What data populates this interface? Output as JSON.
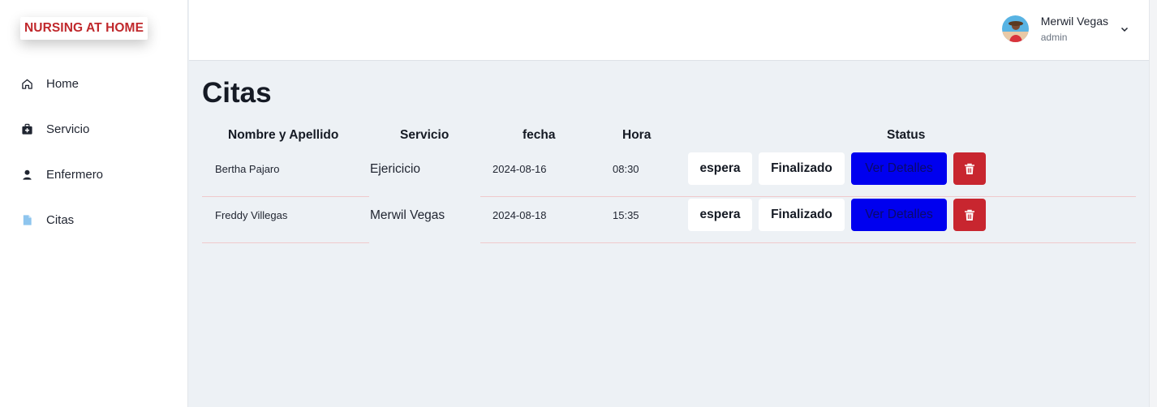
{
  "brand": {
    "name": "NURSING AT HOME"
  },
  "sidebar": {
    "items": [
      {
        "label": "Home",
        "icon": "home-icon"
      },
      {
        "label": "Servicio",
        "icon": "medical-bag-icon"
      },
      {
        "label": "Enfermero",
        "icon": "user-icon"
      },
      {
        "label": "Citas",
        "icon": "document-icon"
      }
    ]
  },
  "user": {
    "name": "Merwil Vegas",
    "role": "admin"
  },
  "page": {
    "title": "Citas"
  },
  "table": {
    "headers": {
      "nombre": "Nombre y Apellido",
      "servicio": "Servicio",
      "fecha": "fecha",
      "hora": "Hora",
      "status": "Status"
    },
    "rows": [
      {
        "nombre": "Bertha Pajaro",
        "servicio": "Ejericicio",
        "fecha": "2024-08-16",
        "hora": "08:30"
      },
      {
        "nombre": "Freddy Villegas",
        "servicio": "Merwil Vegas",
        "fecha": "2024-08-18",
        "hora": "15:35"
      }
    ],
    "actions": {
      "espera": "espera",
      "finalizado": "Finalizado",
      "ver_detalles": "Ver Detalles"
    }
  },
  "colors": {
    "brand": "#c0282c",
    "blue_button": "#0000ef",
    "delete_button": "#c8262f",
    "background": "#edf1f5"
  }
}
